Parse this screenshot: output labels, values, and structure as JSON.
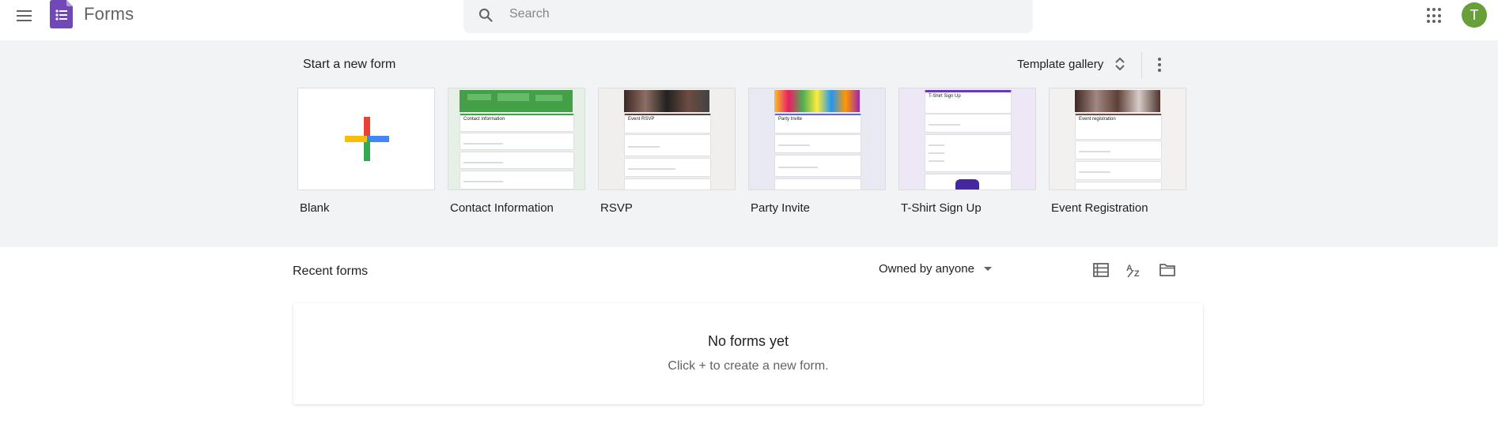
{
  "header": {
    "app_title": "Forms",
    "search_placeholder": "Search",
    "avatar_initial": "T",
    "brand_color": "#7248b9"
  },
  "templates_section": {
    "title": "Start a new form",
    "gallery_label": "Template gallery",
    "templates": [
      {
        "label": "Blank",
        "accent": "#ffffff"
      },
      {
        "label": "Contact Information",
        "accent": "#43a047",
        "card_title": "Contact information"
      },
      {
        "label": "RSVP",
        "accent": "#5d4037",
        "card_title": "Event RSVP"
      },
      {
        "label": "Party Invite",
        "accent": "#5c6bc0",
        "card_title": "Party Invite"
      },
      {
        "label": "T-Shirt Sign Up",
        "accent": "#673ab7",
        "card_title": "T-Shirt Sign Up"
      },
      {
        "label": "Event Registration",
        "accent": "#6d4c41",
        "card_title": "Event registration"
      }
    ]
  },
  "recent": {
    "title": "Recent forms",
    "owner_filter": "Owned by anyone",
    "empty_title": "No forms yet",
    "empty_subtitle": "Click + to create a new form."
  }
}
